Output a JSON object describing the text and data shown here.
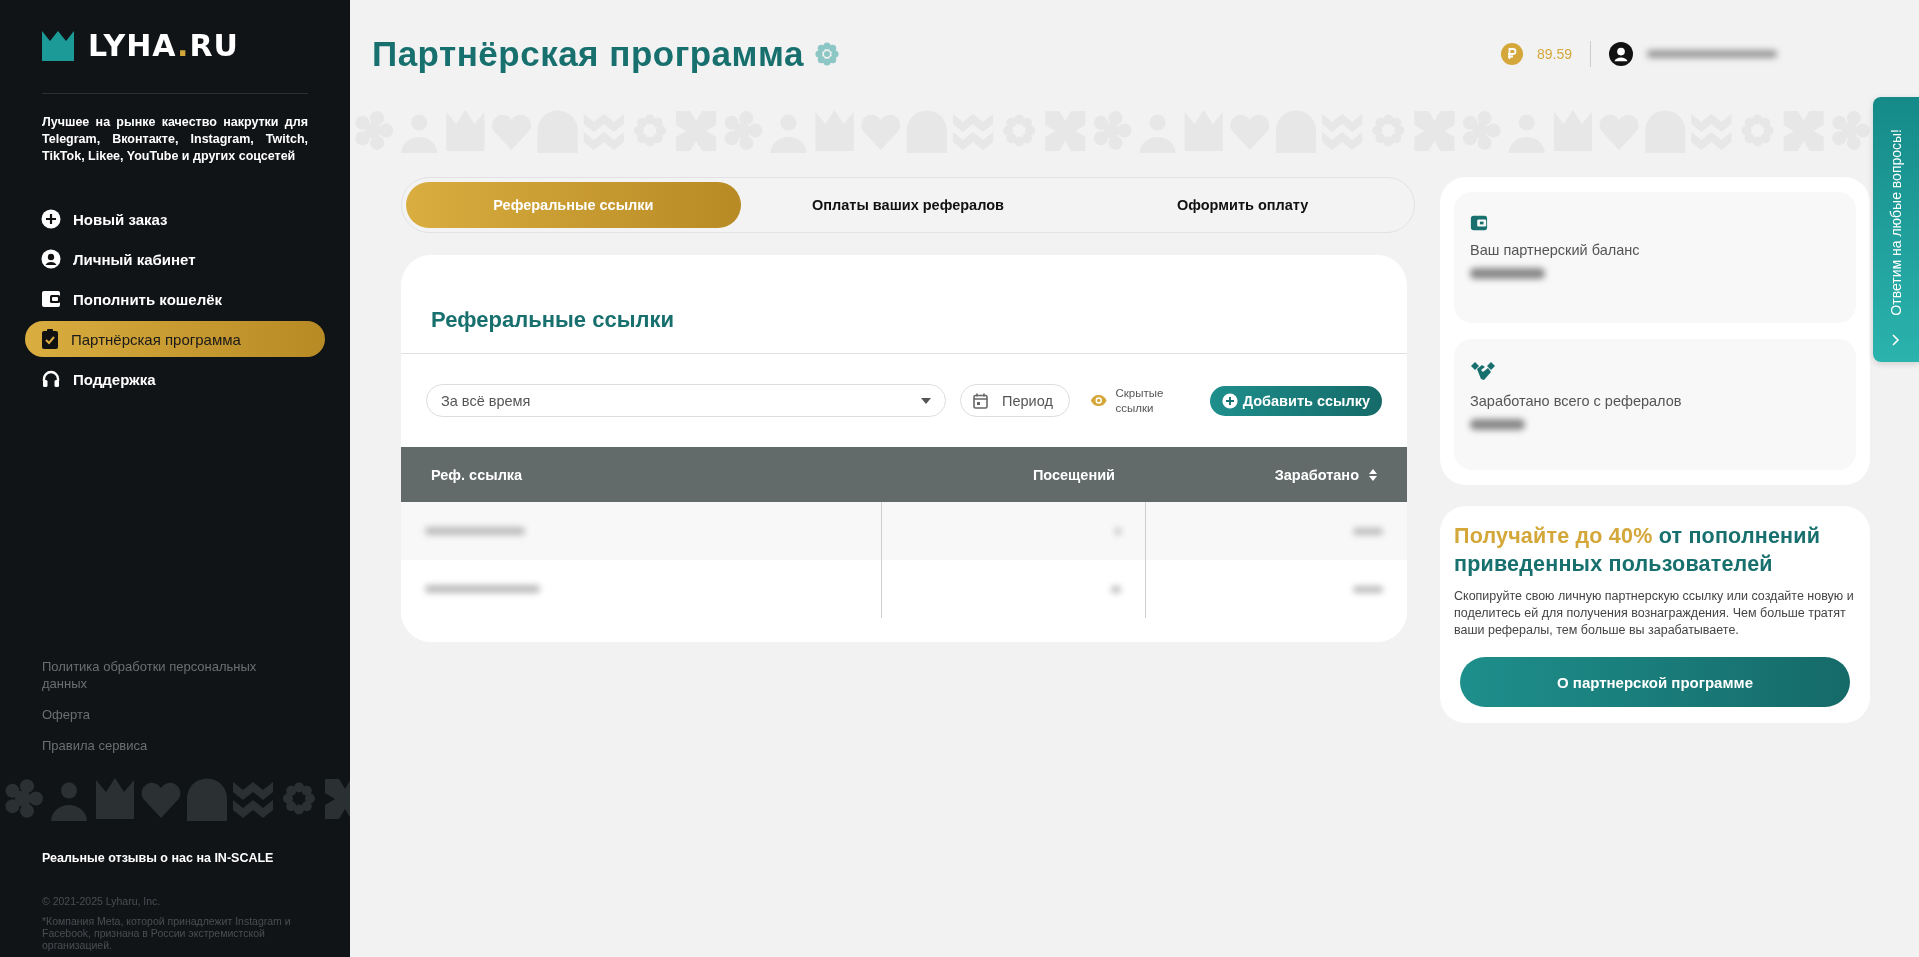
{
  "sidebar": {
    "logo": {
      "main": "LYHA",
      "dot": ".",
      "tld": "RU"
    },
    "tagline": "Лучшее на рынке качество накрутки для Telegram, Вконтакте, Instagram, Twitch, TikTok, Likee, YouTube и других соцсетей",
    "items": [
      {
        "label": "Новый заказ",
        "selected": false
      },
      {
        "label": "Личный кабинет",
        "selected": false
      },
      {
        "label": "Пополнить кошелёк",
        "selected": false
      },
      {
        "label": "Партнёрская программа",
        "selected": true
      },
      {
        "label": "Поддержка",
        "selected": false
      }
    ],
    "footer_links": [
      "Политика обработки персональных данных",
      "Оферта",
      "Правила сервиса"
    ],
    "reviews_link": "Реальные отзывы о нас на IN-SCALE",
    "copyright": "© 2021-2025 Lyharu, Inc.",
    "note": "*Компания Meta, которой принадлежит Instagram и Facebook, признана в России экстремистской организацией."
  },
  "header": {
    "title": "Партнёрская программа",
    "balance": "89.59",
    "email_hidden": true
  },
  "tabs": [
    {
      "label": "Реферальные ссылки",
      "selected": true
    },
    {
      "label": "Оплаты ваших рефералов",
      "selected": false
    },
    {
      "label": "Оформить оплату",
      "selected": false
    }
  ],
  "links_card": {
    "title": "Реферальные ссылки",
    "period_select": {
      "value": "За всё время"
    },
    "period_field": {
      "placeholder": "Период"
    },
    "hidden_toggle": {
      "label": "Скрытые ссылки"
    },
    "add_button": "Добавить ссылку",
    "table": {
      "columns": [
        {
          "label": "Реф. ссылка",
          "sortable": false
        },
        {
          "label": "Посещений",
          "sortable": false
        },
        {
          "label": "Заработано",
          "sortable": true
        }
      ],
      "rows": [
        {
          "kind": "redacted"
        },
        {
          "kind": "redacted"
        }
      ]
    }
  },
  "stats": [
    {
      "label": "Ваш партнерский баланс",
      "value_hidden": true
    },
    {
      "label": "Заработано всего с рефералов",
      "value_hidden": true
    }
  ],
  "promo": {
    "highlight": "Получайте до 40%",
    "heading": "от пополнений приведенных пользователей",
    "text": "Скопируйте свою личную партнерскую ссылку или создайте новую и поделитесь ей для получения вознаграждения. Чем больше тратят ваши рефералы, тем больше вы зарабатываете.",
    "button": "О партнерской программе"
  },
  "side_tab": {
    "label": "Ответим на любые вопросы!"
  }
}
